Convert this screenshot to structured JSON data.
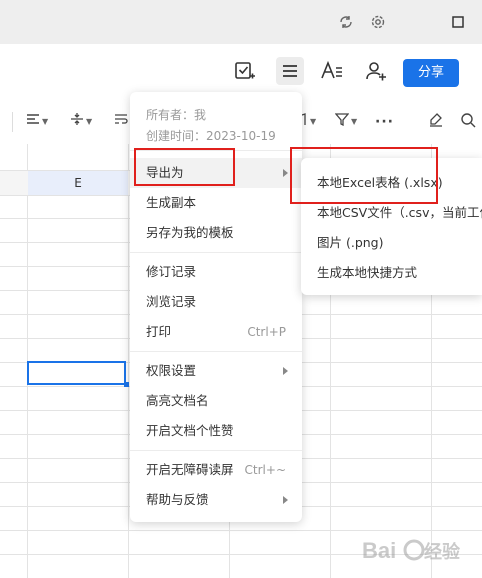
{
  "window": {
    "icons": [
      "refresh-icon",
      "settings-icon",
      "maximize-icon"
    ]
  },
  "toolbar": {
    "share_label": "分享",
    "icons": [
      "edit-check-icon",
      "menu-icon",
      "text-format-icon",
      "add-user-icon"
    ]
  },
  "formatbar": {
    "icons": [
      "align-icon",
      "vertical-align-icon",
      "wrap-icon",
      "number-format-icon",
      "filter-icon",
      "more-icon",
      "clear-format-icon",
      "search-icon"
    ]
  },
  "sheet": {
    "column_header": "E"
  },
  "menu": {
    "owner": "所有者：我",
    "created": "创建时间：2023-10-19",
    "items": [
      {
        "label": "导出为",
        "shortcut": "",
        "submenu": true
      },
      {
        "label": "生成副本",
        "shortcut": "",
        "submenu": false
      },
      {
        "label": "另存为我的模板",
        "shortcut": "",
        "submenu": false
      },
      {
        "label": "修订记录",
        "shortcut": "",
        "submenu": false
      },
      {
        "label": "浏览记录",
        "shortcut": "",
        "submenu": false
      },
      {
        "label": "打印",
        "shortcut": "Ctrl+P",
        "submenu": false
      },
      {
        "label": "权限设置",
        "shortcut": "",
        "submenu": true
      },
      {
        "label": "高亮文档名",
        "shortcut": "",
        "submenu": false
      },
      {
        "label": "开启文档个性赞",
        "shortcut": "",
        "submenu": false
      },
      {
        "label": "开启无障碍读屏",
        "shortcut": "Ctrl+~",
        "submenu": false
      },
      {
        "label": "帮助与反馈",
        "shortcut": "",
        "submenu": true
      }
    ]
  },
  "submenu": {
    "items": [
      {
        "label": "本地Excel表格 (.xlsx)"
      },
      {
        "label": "本地CSV文件（.csv，当前工作表）"
      },
      {
        "label": "图片 (.png)"
      },
      {
        "label": "生成本地快捷方式"
      }
    ]
  },
  "watermark": {
    "text": "Baidu 经验"
  },
  "colors": {
    "accent": "#1a73e8",
    "highlight_box": "#e0201c"
  }
}
